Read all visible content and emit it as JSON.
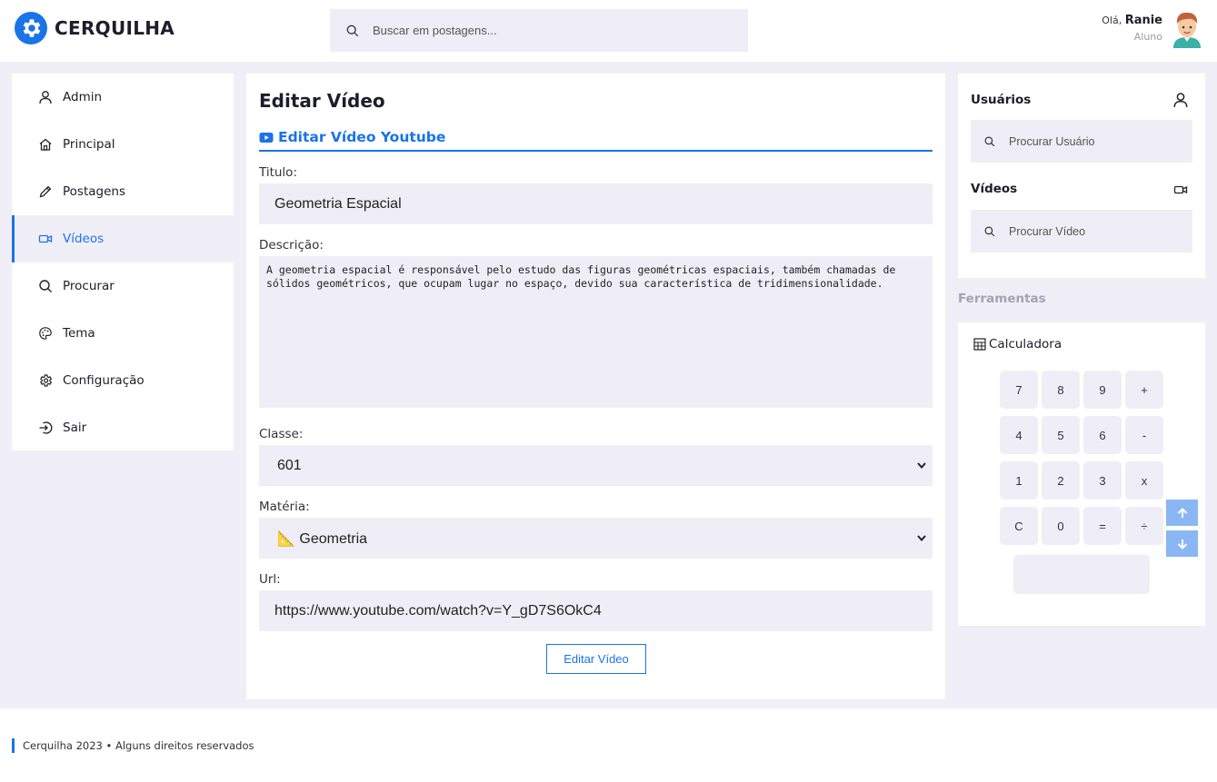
{
  "header": {
    "app_name": "CERQUILHA",
    "search_placeholder": "Buscar em postagens...",
    "user_greeting": "Olá,",
    "user_name": "Ranie",
    "user_role": "Aluno"
  },
  "sidebar": {
    "items": [
      {
        "label": "Admin",
        "icon": "user-icon",
        "active": false
      },
      {
        "label": "Principal",
        "icon": "home-icon",
        "active": false
      },
      {
        "label": "Postagens",
        "icon": "pencil-icon",
        "active": false
      },
      {
        "label": "Vídeos",
        "icon": "video-icon",
        "active": true
      },
      {
        "label": "Procurar",
        "icon": "search-icon",
        "active": false
      },
      {
        "label": "Tema",
        "icon": "palette-icon",
        "active": false
      },
      {
        "label": "Configuração",
        "icon": "gear-icon",
        "active": false
      },
      {
        "label": "Sair",
        "icon": "logout-icon",
        "active": false
      }
    ]
  },
  "main": {
    "page_title": "Editar Vídeo",
    "section_title": "Editar Vídeo Youtube",
    "title_label": "Titulo:",
    "title_value": "Geometria Espacial",
    "description_label": "Descrição:",
    "description_value": "A geometria espacial é responsável pelo estudo das figuras geométricas espaciais, também chamadas de sólidos geométricos, que ocupam lugar no espaço, devido sua característica de tridimensionalidade.",
    "class_label": "Classe:",
    "class_value": "601",
    "subject_label": "Matéria:",
    "subject_value": "📐 Geometria",
    "url_label": "Url:",
    "url_value": "https://www.youtube.com/watch?v=Y_gD7S6OkC4",
    "submit_label": "Editar Vídeo"
  },
  "right": {
    "users_title": "Usuários",
    "users_search_placeholder": "Procurar Usuário",
    "videos_title": "Vídeos",
    "videos_search_placeholder": "Procurar Vídeo",
    "tools_title": "Ferramentas",
    "calculator_title": "Calculadora",
    "calculator_keys": [
      "7",
      "8",
      "9",
      "+",
      "4",
      "5",
      "6",
      "-",
      "1",
      "2",
      "3",
      "x",
      "C",
      "0",
      "=",
      "÷"
    ],
    "calculator_display": ""
  },
  "footer": {
    "text": "Cerquilha 2023 • Alguns direitos reservados"
  },
  "colors": {
    "accent": "#1a73e8",
    "background": "#f0eff7",
    "field": "#efeef6",
    "scroll_button": "#8ab7f3"
  }
}
